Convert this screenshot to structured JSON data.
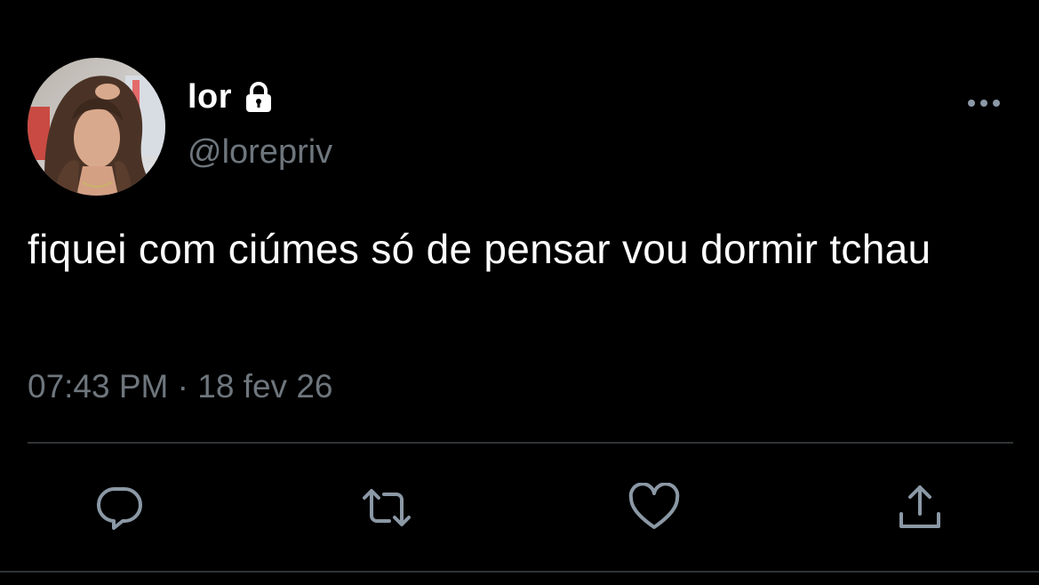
{
  "tweet": {
    "display_name": "lor",
    "handle": "@lorepriv",
    "text": "fiquei com ciúmes só de pensar vou dormir tchau",
    "timestamp": "07:43 PM · 18 fev 26",
    "protected": true
  },
  "icons": {
    "lock": "lock-icon",
    "more": "more-dots-icon",
    "reply": "reply-bubble-icon",
    "retweet": "retweet-icon",
    "like": "heart-icon",
    "share": "share-upload-icon"
  },
  "colors": {
    "background": "#000000",
    "primary_text": "#ffffff",
    "secondary_text": "#6e767d",
    "icon": "#8b98a5",
    "divider": "#2f3336"
  }
}
